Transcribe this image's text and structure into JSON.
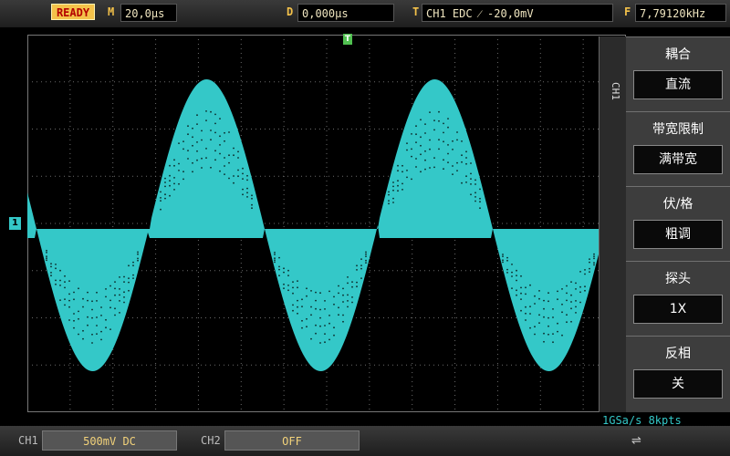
{
  "status": {
    "ready": "READY"
  },
  "header": {
    "horizontal": {
      "label": "M",
      "value": "20,0µs"
    },
    "delay": {
      "label": "D",
      "value": "0,000µs"
    },
    "trigger": {
      "label": "T",
      "value": "CH1 EDC ⁄ -20,0mV"
    },
    "frequency": {
      "label": "F",
      "value": "7,79120kHz"
    }
  },
  "markers": {
    "trigger": "T",
    "channel": "1"
  },
  "side_menu": {
    "tab_label": "CH1",
    "items": [
      {
        "title": "耦合",
        "value": "直流"
      },
      {
        "title": "带宽限制",
        "value": "满带宽"
      },
      {
        "title": "伏/格",
        "value": "粗调"
      },
      {
        "title": "探头",
        "value": "1X"
      },
      {
        "title": "反相",
        "value": "关"
      }
    ]
  },
  "sample_info": "1GSa/s 8kpts",
  "footer": {
    "ch1": {
      "label": "CH1",
      "value": "500mV DC"
    },
    "ch2": {
      "label": "CH2",
      "value": "OFF"
    },
    "usb_icon": "usb-icon"
  },
  "colors": {
    "trace": "#34c8c8",
    "grid": "#6a6a6a",
    "accent": "#f4c24a"
  }
}
